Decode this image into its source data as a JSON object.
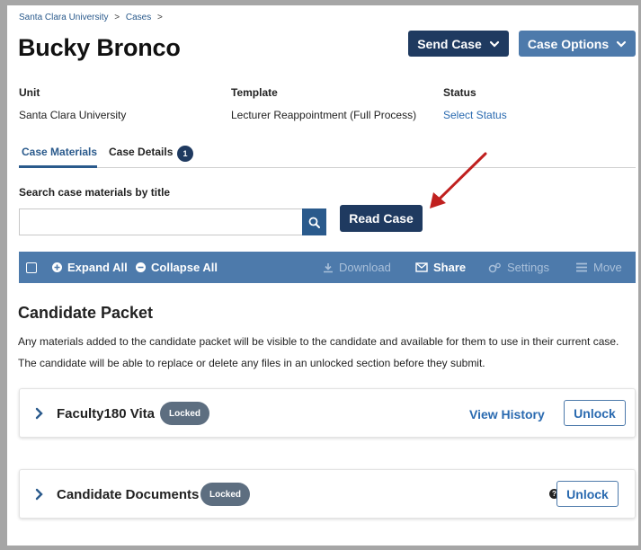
{
  "breadcrumb": {
    "items": [
      "Santa Clara University",
      "Cases"
    ],
    "separator": ">"
  },
  "page": {
    "title": "Bucky Bronco"
  },
  "header_buttons": {
    "send_case": "Send Case",
    "case_options": "Case Options"
  },
  "meta": {
    "unit_label": "Unit",
    "unit_value": "Santa Clara University",
    "template_label": "Template",
    "template_value": "Lecturer Reappointment (Full Process)",
    "status_label": "Status",
    "status_value": "Select Status"
  },
  "tabs": {
    "materials": "Case Materials",
    "details": "Case Details",
    "details_badge": "1"
  },
  "search": {
    "label": "Search case materials by title",
    "placeholder": "",
    "value": ""
  },
  "read_case": "Read Case",
  "toolbar": {
    "expand_all": "Expand All",
    "collapse_all": "Collapse All",
    "download": "Download",
    "share": "Share",
    "settings": "Settings",
    "move": "Move"
  },
  "packet": {
    "title": "Candidate Packet",
    "desc1": "Any materials added to the candidate packet will be visible to the candidate and available for them to use in their current case.",
    "desc2": "The candidate will be able to replace or delete any files in an unlocked section before they submit."
  },
  "cards": [
    {
      "title": "Faculty180 Vita",
      "badge": "Locked",
      "history": "View History",
      "action": "Unlock"
    },
    {
      "title": "Candidate Documents",
      "badge": "Locked",
      "help": "?",
      "action": "Unlock"
    }
  ],
  "colors": {
    "primary_dark": "#1f3a60",
    "primary": "#4d7aab",
    "link": "#2a6ab0",
    "annotation_arrow": "#c0201f"
  }
}
